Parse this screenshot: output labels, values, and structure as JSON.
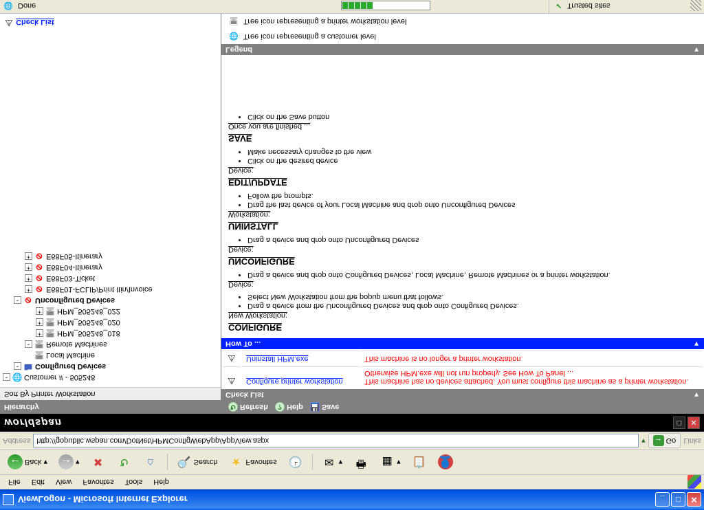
{
  "window": {
    "title": "ViewLogon - Microsoft Internet Explorer"
  },
  "menu": [
    "File",
    "Edit",
    "View",
    "Favorites",
    "Tools",
    "Help"
  ],
  "toolbar": {
    "back": "Back",
    "search": "Search",
    "favorites": "Favorites"
  },
  "address": {
    "label": "Address",
    "url": "http://gopublic.wspan.com/DotNet/HPMConfigWebApp/AppView.aspx",
    "go": "Go",
    "links": "Links"
  },
  "app": {
    "logo": "worldspan"
  },
  "actions": {
    "hierarchy": "Hierarchy",
    "refresh": "Refresh",
    "help": "Help",
    "save": "Save"
  },
  "sidebar": {
    "sortby": "Sort By Printer Workstation",
    "root": "Customer # - 505248",
    "configured": "Configured Devices",
    "local": "Local Machine",
    "remote": "Remote Machines",
    "remoteItems": [
      "HPM_505248_018",
      "HPM_505248_020",
      "HPM_505248_022"
    ],
    "unconfigured": "Unconfigured Devices",
    "unItems": [
      "E68F01-FCLIP/Print Itin/Invoice",
      "E68F03-Ticket",
      "E68F04-Itinerary",
      "E68F05-Itinerary"
    ],
    "checklist": "Check List"
  },
  "checklist": {
    "title": "Check List",
    "rows": [
      {
        "task": "Configure printer workstation",
        "msg": "This machine has no devices attached.  You must configure this machine as a printer workstation.  Otherwise HPM.exe will not run properly.  See How To Panel ..."
      },
      {
        "task": "Uninstall HPM.exe",
        "msg": "This machine is no longer a printer workstation."
      }
    ]
  },
  "howto": {
    "title": "How To ...",
    "sections": [
      {
        "h": "CONFIGURE",
        "sub": "New Workstation:",
        "items": [
          "Drag a device from the Unconfigured Devices and drop onto Configured Devices.",
          "Select New Workstation from the popup menu that follows."
        ],
        "sub2": "Device:",
        "items2": [
          "Drag a device and drop onto Configured Devices, Local Machine, Remote Machines or a printer workstation."
        ]
      },
      {
        "h": "UNCONFIGURE",
        "sub": "Device:",
        "items": [
          "Drag a device and drop onto Unconfigured Devices"
        ]
      },
      {
        "h": "UNINSTALL",
        "sub": "Workstation:",
        "items": [
          "Drag the last device of your Local Machine and drop onto Unconfigured Devices",
          "Follow the prompts."
        ]
      },
      {
        "h": "EDIT/UPDATE",
        "sub": "Device:",
        "items": [
          "Click on the desired device",
          "Make necessary changes to the view"
        ]
      },
      {
        "h": "SAVE",
        "sub": "Once you are finished ...",
        "items": [
          "Click on the Save button"
        ]
      }
    ]
  },
  "legend": {
    "title": "Legend",
    "rows": [
      "Tree icon representing a customer level",
      "Tree icon representing a printer workstation level"
    ]
  },
  "status": {
    "done": "Done",
    "trusted": "Trusted sites"
  }
}
